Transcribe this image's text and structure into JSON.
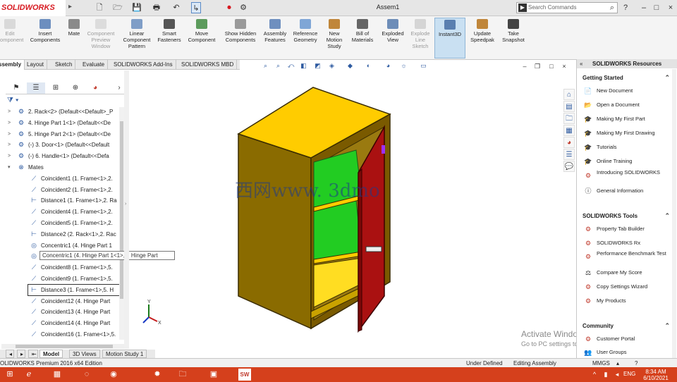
{
  "app": {
    "logo": "SOLIDWORKS",
    "document": "Assem1"
  },
  "quick_access": [
    "🗋",
    "🗁",
    "💾",
    "🖶",
    "↶",
    "↳",
    "⚙"
  ],
  "search": {
    "placeholder": "Search Commands"
  },
  "window_buttons": [
    "?",
    "–",
    "□",
    "×"
  ],
  "ribbon": [
    {
      "label": "Edit Component",
      "disabled": true
    },
    {
      "label": "Insert Components"
    },
    {
      "label": "Mate"
    },
    {
      "label": "Component Preview Window",
      "disabled": true
    },
    {
      "label": "Linear Component Pattern"
    },
    {
      "label": "Smart Fasteners"
    },
    {
      "label": "Move Component"
    },
    {
      "label": "Show Hidden Components"
    },
    {
      "label": "Assembly Features"
    },
    {
      "label": "Reference Geometry"
    },
    {
      "label": "New Motion Study"
    },
    {
      "label": "Bill of Materials"
    },
    {
      "label": "Exploded View"
    },
    {
      "label": "Explode Line Sketch",
      "disabled": true
    },
    {
      "label": "Instant3D",
      "active": true
    },
    {
      "label": "Update Speedpak"
    },
    {
      "label": "Take Snapshot"
    }
  ],
  "tabs": [
    "ssembly",
    "Layout",
    "Sketch",
    "Evaluate",
    "SOLIDWORKS Add-Ins",
    "SOLIDWORKS MBD"
  ],
  "tree": [
    {
      "label": "2. Rack<2> (Default<<Default>_P",
      "type": "part",
      "expand": ">"
    },
    {
      "label": "4. Hinge Part 1<1> (Default<<De",
      "type": "part",
      "expand": ">"
    },
    {
      "label": "5. Hinge Part 2<1> (Default<<De",
      "type": "part",
      "expand": ">"
    },
    {
      "label": "(-) 3. Door<1> (Default<<Default",
      "type": "part",
      "expand": ">"
    },
    {
      "label": "(-) 6. Handle<1> (Default<<Defa",
      "type": "part",
      "expand": ">"
    },
    {
      "label": "Mates",
      "type": "mates",
      "expand": "▾"
    },
    {
      "label": "Coincident1 (1. Frame<1>,2.",
      "type": "coin"
    },
    {
      "label": "Coincident2 (1. Frame<1>,2.",
      "type": "coin"
    },
    {
      "label": "Distance1 (1. Frame<1>,2. Ra",
      "type": "dist"
    },
    {
      "label": "Coincident4 (1. Frame<1>,2.",
      "type": "coin"
    },
    {
      "label": "Coincident5 (1. Frame<1>,2.",
      "type": "coin"
    },
    {
      "label": "Distance2 (2. Rack<1>,2. Rac",
      "type": "dist"
    },
    {
      "label": "Concentric1 (4. Hinge Part 1",
      "type": "conc"
    },
    {
      "label": "",
      "type": "conc"
    },
    {
      "label": "Coincident8 (1. Frame<1>,5.",
      "type": "coin"
    },
    {
      "label": "Coincident9 (1. Frame<1>,5.",
      "type": "coin"
    },
    {
      "label": "Distance3 (1. Frame<1>,5. H",
      "type": "dist",
      "boxed": true
    },
    {
      "label": "Coincident12 (4. Hinge Part",
      "type": "coin"
    },
    {
      "label": "Coincident13 (4. Hinge Part",
      "type": "coin"
    },
    {
      "label": "Coincident14 (4. Hinge Part",
      "type": "coin"
    },
    {
      "label": "Coincident16 (1. Frame<1>,5.",
      "type": "coin"
    }
  ],
  "tooltip": "Concentric1 (4. Hinge Part 1<1>,5. Hinge Part",
  "bottom_tabs": [
    "Model",
    "3D Views",
    "Motion Study 1"
  ],
  "status": {
    "left": "OLIDWORKS Premium 2016 x64 Edition",
    "defined": "Under Defined",
    "mode": "Editing Assembly",
    "units": "MMGS"
  },
  "watermark": "西网www. 3dmo",
  "activate": {
    "title": "Activate Windows",
    "sub": "Go to PC settings to activate Windows."
  },
  "taskpane": {
    "title": "SOLIDWORKS Resources",
    "sections": [
      {
        "title": "Getting Started",
        "items": [
          {
            "label": "New Document",
            "icon": "📄"
          },
          {
            "label": "Open a Document",
            "icon": "📂"
          },
          {
            "label": "Making My First Part",
            "icon": "🎓"
          },
          {
            "label": "Making My First Drawing",
            "icon": "🎓"
          },
          {
            "label": "Tutorials",
            "icon": "🎓"
          },
          {
            "label": "Online Training",
            "icon": "🎓"
          },
          {
            "label": "Introducing SOLIDWORKS",
            "icon": "⚙",
            "two": true
          },
          {
            "label": "General Information",
            "icon": "ⓘ"
          }
        ]
      },
      {
        "title": "SOLIDWORKS Tools",
        "items": [
          {
            "label": "Property Tab Builder",
            "icon": "⚙"
          },
          {
            "label": "SOLIDWORKS Rx",
            "icon": "⚙"
          },
          {
            "label": "Performance Benchmark Test",
            "icon": "⚙",
            "two": true
          },
          {
            "label": "Compare My Score",
            "icon": "⚖"
          },
          {
            "label": "Copy Settings Wizard",
            "icon": "⚙"
          },
          {
            "label": "My Products",
            "icon": "⚙"
          }
        ]
      },
      {
        "title": "Community",
        "items": [
          {
            "label": "Customer Portal",
            "icon": "⚙"
          },
          {
            "label": "User Groups",
            "icon": "👥"
          }
        ]
      }
    ]
  },
  "clock": {
    "time": "8:34 AM",
    "date": "6/10/2021"
  },
  "lang": "ENG",
  "colors": {
    "frame": "#7a5a00",
    "top": "#ffcc00",
    "shelf": "#22cc22",
    "door": "#aa1111",
    "taskbar": "#d5401c"
  }
}
